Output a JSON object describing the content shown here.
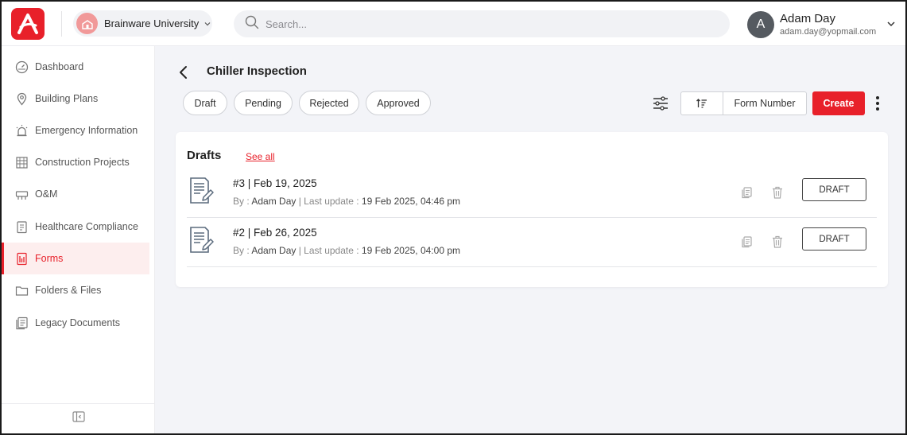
{
  "header": {
    "org_name": "Brainware University",
    "search_placeholder": "Search...",
    "user": {
      "initial": "A",
      "name": "Adam Day",
      "email": "adam.day@yopmail.com"
    }
  },
  "sidebar": {
    "items": [
      {
        "label": "Dashboard",
        "icon": "gauge-icon"
      },
      {
        "label": "Building Plans",
        "icon": "map-pin-icon"
      },
      {
        "label": "Emergency Information",
        "icon": "alarm-light-icon"
      },
      {
        "label": "Construction Projects",
        "icon": "construction-icon"
      },
      {
        "label": "O&M",
        "icon": "toolbox-icon"
      },
      {
        "label": "Healthcare Compliance",
        "icon": "clipboard-icon"
      },
      {
        "label": "Forms",
        "icon": "form-icon",
        "active": true
      },
      {
        "label": "Folders & Files",
        "icon": "folder-icon"
      },
      {
        "label": "Legacy Documents",
        "icon": "documents-icon"
      }
    ]
  },
  "main": {
    "title": "Chiller Inspection",
    "filters": [
      "Draft",
      "Pending",
      "Rejected",
      "Approved"
    ],
    "sort_field": "Form Number",
    "create_label": "Create",
    "drafts": {
      "title": "Drafts",
      "see_all": "See all",
      "by_label": "By :",
      "last_update_label": "Last update :",
      "items": [
        {
          "title": "#3 | Feb 19, 2025",
          "author": "Adam Day",
          "updated": "19 Feb 2025, 04:46 pm",
          "status": "DRAFT"
        },
        {
          "title": "#2 | Feb 26, 2025",
          "author": "Adam Day",
          "updated": "19 Feb 2025, 04:00 pm",
          "status": "DRAFT"
        }
      ]
    }
  },
  "colors": {
    "brand": "#e8202a",
    "active_bg": "#fdeeee",
    "page_bg": "#f3f4f8"
  }
}
